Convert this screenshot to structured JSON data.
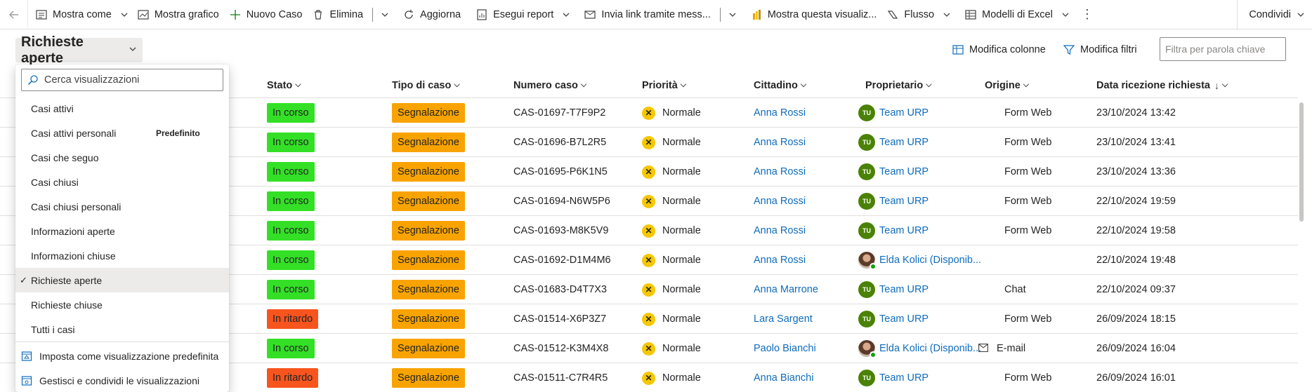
{
  "toolbar": {
    "items": [
      {
        "label": "Mostra come",
        "icon": "list-icon"
      },
      {
        "label": "Mostra grafico",
        "icon": "chart-icon"
      },
      {
        "label": "Nuovo Caso",
        "icon": "plus-icon"
      },
      {
        "label": "Elimina",
        "icon": "trash-icon"
      },
      {
        "label": "Aggiorna",
        "icon": "refresh-icon"
      },
      {
        "label": "Esegui report",
        "icon": "report-icon"
      },
      {
        "label": "Invia link tramite mess...",
        "icon": "link-icon"
      },
      {
        "label": "Mostra questa visualiz...",
        "icon": "powerbi-icon"
      },
      {
        "label": "Flusso",
        "icon": "flow-icon"
      },
      {
        "label": "Modelli di Excel",
        "icon": "excel-icon"
      }
    ],
    "share_label": "Condividi"
  },
  "view": {
    "title": "Richieste aperte",
    "edit_columns_label": "Modifica colonne",
    "edit_filters_label": "Modifica filtri",
    "keyword_placeholder": "Filtra per parola chiave"
  },
  "dropdown": {
    "search_placeholder": "Cerca visualizzazioni",
    "items": [
      {
        "label": "Casi attivi",
        "badge": "",
        "selected": false
      },
      {
        "label": "Casi attivi personali",
        "badge": "Predefinito",
        "selected": false
      },
      {
        "label": "Casi che seguo",
        "badge": "",
        "selected": false
      },
      {
        "label": "Casi chiusi",
        "badge": "",
        "selected": false
      },
      {
        "label": "Casi chiusi personali",
        "badge": "",
        "selected": false
      },
      {
        "label": "Informazioni aperte",
        "badge": "",
        "selected": false
      },
      {
        "label": "Informazioni chiuse",
        "badge": "",
        "selected": false
      },
      {
        "label": "Richieste aperte",
        "badge": "",
        "selected": true
      },
      {
        "label": "Richieste chiuse",
        "badge": "",
        "selected": false
      },
      {
        "label": "Tutti i casi",
        "badge": "",
        "selected": false
      }
    ],
    "actions": [
      {
        "label": "Imposta come visualizzazione predefinita",
        "icon": "default-view-icon"
      },
      {
        "label": "Gestisci e condividi le visualizzazioni",
        "icon": "manage-views-icon"
      }
    ]
  },
  "grid": {
    "columns": [
      "Stato",
      "Tipo di caso",
      "Numero caso",
      "Priorità",
      "Cittadino",
      "Proprietario",
      "Origine",
      "Data ricezione richiesta"
    ],
    "rows": [
      {
        "stato": "In corso",
        "tipo": "Segnalazione",
        "numero": "CAS-01697-T7F9P2",
        "priorita": "Normale",
        "cittadino": "Anna Rossi",
        "proprietario": "Team URP",
        "owner_type": "team",
        "origine": "Form Web",
        "origine_icon": "",
        "data": "23/10/2024 13:42"
      },
      {
        "stato": "In corso",
        "tipo": "Segnalazione",
        "numero": "CAS-01696-B7L2R5",
        "priorita": "Normale",
        "cittadino": "Anna Rossi",
        "proprietario": "Team URP",
        "owner_type": "team",
        "origine": "Form Web",
        "origine_icon": "",
        "data": "23/10/2024 13:41"
      },
      {
        "stato": "In corso",
        "tipo": "Segnalazione",
        "numero": "CAS-01695-P6K1N5",
        "priorita": "Normale",
        "cittadino": "Anna Rossi",
        "proprietario": "Team URP",
        "owner_type": "team",
        "origine": "Form Web",
        "origine_icon": "",
        "data": "23/10/2024 13:36"
      },
      {
        "stato": "In corso",
        "tipo": "Segnalazione",
        "numero": "CAS-01694-N6W5P6",
        "priorita": "Normale",
        "cittadino": "Anna Rossi",
        "proprietario": "Team URP",
        "owner_type": "team",
        "origine": "Form Web",
        "origine_icon": "",
        "data": "22/10/2024 19:59"
      },
      {
        "stato": "In corso",
        "tipo": "Segnalazione",
        "numero": "CAS-01693-M8K5V9",
        "priorita": "Normale",
        "cittadino": "Anna Rossi",
        "proprietario": "Team URP",
        "owner_type": "team",
        "origine": "Form Web",
        "origine_icon": "",
        "data": "22/10/2024 19:58"
      },
      {
        "stato": "In corso",
        "tipo": "Segnalazione",
        "numero": "CAS-01692-D1M4M6",
        "priorita": "Normale",
        "cittadino": "Anna Rossi",
        "proprietario": "Elda Kolici (Disponib...",
        "owner_type": "user",
        "origine": "",
        "origine_icon": "",
        "data": "22/10/2024 19:48"
      },
      {
        "stato": "In corso",
        "tipo": "Segnalazione",
        "numero": "CAS-01683-D4T7X3",
        "priorita": "Normale",
        "cittadino": "Anna Marrone",
        "proprietario": "Team URP",
        "owner_type": "team",
        "origine": "Chat",
        "origine_icon": "",
        "data": "22/10/2024 09:37"
      },
      {
        "stato": "In ritardo",
        "tipo": "Segnalazione",
        "numero": "CAS-01514-X6P3Z7",
        "priorita": "Normale",
        "cittadino": "Lara Sargent",
        "proprietario": "Team URP",
        "owner_type": "team",
        "origine": "Form Web",
        "origine_icon": "",
        "data": "26/09/2024 18:15"
      },
      {
        "stato": "In corso",
        "tipo": "Segnalazione",
        "numero": "CAS-01512-K3M4X8",
        "priorita": "Normale",
        "cittadino": "Paolo Bianchi",
        "proprietario": "Elda Kolici (Disponib...",
        "owner_type": "user",
        "origine": "E-mail",
        "origine_icon": "mail-icon",
        "data": "26/09/2024 16:04"
      },
      {
        "stato": "In ritardo",
        "tipo": "Segnalazione",
        "numero": "CAS-01511-C7R4R5",
        "priorita": "Normale",
        "cittadino": "Anna Bianchi",
        "proprietario": "Team URP",
        "owner_type": "team",
        "origine": "Form Web",
        "origine_icon": "",
        "data": "26/09/2024 16:01"
      }
    ],
    "team_initials": "TU",
    "priority_glyph": "✕"
  },
  "colors": {
    "in_corso": "#33e026",
    "in_ritardo": "#f7541e",
    "segnalazione": "#f9a300",
    "accent": "#0f6cbd"
  }
}
